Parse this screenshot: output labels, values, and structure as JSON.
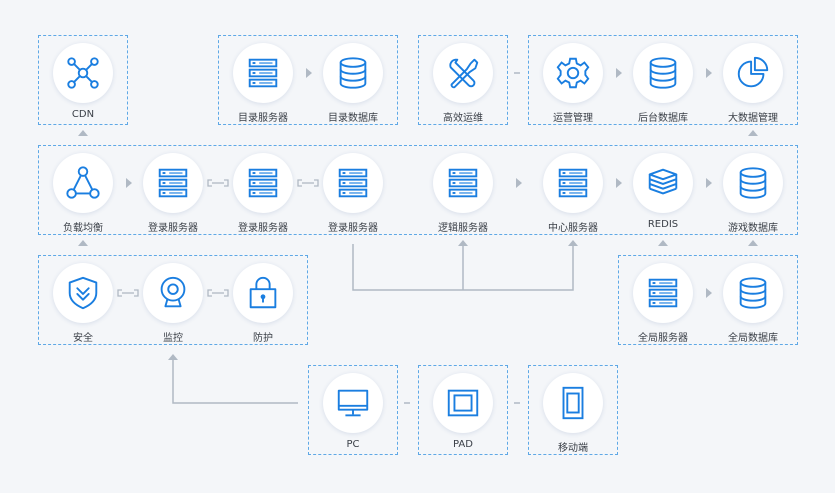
{
  "colors": {
    "accent": "#1a7ee0",
    "border": "#5ea8e6",
    "connector": "#b0b9c4",
    "text": "#3b4048",
    "background": "#f4f6f9"
  },
  "nodes": {
    "cdn": {
      "label": "CDN",
      "icon": "network-hub-icon"
    },
    "dir_server": {
      "label": "目录服务器",
      "icon": "server-icon"
    },
    "dir_db": {
      "label": "目录数据库",
      "icon": "database-icon"
    },
    "ops": {
      "label": "高效运维",
      "icon": "tools-icon"
    },
    "operation_mgmt": {
      "label": "运营管理",
      "icon": "gear-icon"
    },
    "backend_db": {
      "label": "后台数据库",
      "icon": "database-icon"
    },
    "bigdata_mgmt": {
      "label": "大数据管理",
      "icon": "pie-chart-icon"
    },
    "load_balance": {
      "label": "负载均衡",
      "icon": "load-balance-icon"
    },
    "login_server_1": {
      "label": "登录服务器",
      "icon": "server-icon"
    },
    "login_server_2": {
      "label": "登录服务器",
      "icon": "server-icon"
    },
    "login_server_3": {
      "label": "登录服务器",
      "icon": "server-icon"
    },
    "logic_server": {
      "label": "逻辑服务器",
      "icon": "server-icon"
    },
    "center_server": {
      "label": "中心服务器",
      "icon": "server-icon"
    },
    "redis": {
      "label": "REDIS",
      "icon": "redis-stack-icon"
    },
    "game_db": {
      "label": "游戏数据库",
      "icon": "database-icon"
    },
    "security": {
      "label": "安全",
      "icon": "shield-icon"
    },
    "monitor": {
      "label": "监控",
      "icon": "webcam-icon"
    },
    "protection": {
      "label": "防护",
      "icon": "lock-icon"
    },
    "global_server": {
      "label": "全局服务器",
      "icon": "server-icon"
    },
    "global_db": {
      "label": "全局数据库",
      "icon": "database-icon"
    },
    "pc": {
      "label": "PC",
      "icon": "monitor-icon"
    },
    "pad": {
      "label": "PAD",
      "icon": "tablet-landscape-icon"
    },
    "mobile": {
      "label": "移动端",
      "icon": "mobile-phone-icon"
    }
  }
}
